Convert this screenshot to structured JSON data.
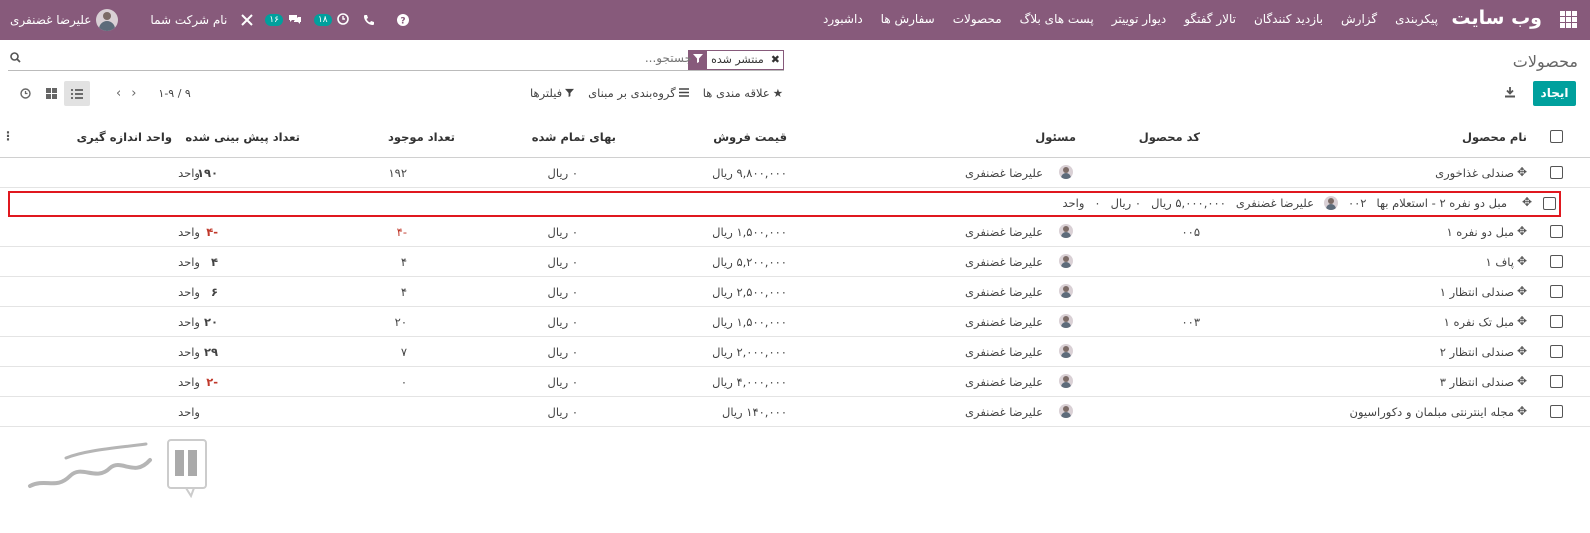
{
  "topbar": {
    "brand": "وب سایت",
    "menu": [
      "داشبورد",
      "سفارش ها",
      "محصولات",
      "پست های بلاگ",
      "دیوار توییتر",
      "تالار گفتگو",
      "بازدید کنندگان",
      "گزارش",
      "پیکربندی"
    ],
    "user_name": "علیرضا غضنفری",
    "company": "نام شرکت شما",
    "messages_badge": "۱۶",
    "activities_badge": "۱۸",
    "icons": [
      "apps-grid-icon",
      "help-icon",
      "phone-icon",
      "clock-icon",
      "chat-icon",
      "tools-icon"
    ],
    "colors": {
      "bar": "#875a7b",
      "accent": "#00a09d"
    }
  },
  "control": {
    "title": "محصولات",
    "facet_label": "منتشر شده",
    "search_placeholder": "جستجو...",
    "create_label": "ایجاد",
    "filters_label": "فیلترها",
    "groupby_label": "گروه‌بندی بر مبنای",
    "favorites_label": "علاقه مندی ها",
    "pager": "۱-۹ / ۹"
  },
  "table": {
    "headers": {
      "name": "نام محصول",
      "code": "کد محصول",
      "responsible": "مسئول",
      "price": "قیمت فروش",
      "cost": "بهای تمام شده",
      "onhand": "تعداد موجود",
      "forecast": "تعداد پیش بینی شده",
      "uom": "واحد اندازه گیری"
    },
    "rows": [
      {
        "name": "صندلی غذاخوری",
        "code": "",
        "responsible": "علیرضا غضنفری",
        "price": "۹,۸۰۰,۰۰۰ ریال",
        "cost": "۰ ریال",
        "onhand": "۱۹۲",
        "forecast": "۱۹۰",
        "uom": "واحد",
        "neg": false
      },
      {
        "name": "مبل دو نفره ۱",
        "code": "۰۰۵",
        "responsible": "علیرضا غضنفری",
        "price": "۱,۵۰۰,۰۰۰ ریال",
        "cost": "۰ ریال",
        "onhand": "-۴",
        "forecast": "-۴",
        "uom": "واحد",
        "neg": true
      },
      {
        "name": "پاف ۱",
        "code": "",
        "responsible": "علیرضا غضنفری",
        "price": "۵,۲۰۰,۰۰۰ ریال",
        "cost": "۰ ریال",
        "onhand": "۴",
        "forecast": "۴",
        "uom": "واحد",
        "neg": false
      },
      {
        "name": "صندلی انتظار ۱",
        "code": "",
        "responsible": "علیرضا غضنفری",
        "price": "۲,۵۰۰,۰۰۰ ریال",
        "cost": "۰ ریال",
        "onhand": "۴",
        "forecast": "۶",
        "uom": "واحد",
        "neg": false
      },
      {
        "name": "مبل تک نفره ۱",
        "code": "۰۰۳",
        "responsible": "علیرضا غضنفری",
        "price": "۱,۵۰۰,۰۰۰ ریال",
        "cost": "۰ ریال",
        "onhand": "۲۰",
        "forecast": "۲۰",
        "uom": "واحد",
        "neg": false
      },
      {
        "name": "صندلی انتظار ۲",
        "code": "",
        "responsible": "علیرضا غضنفری",
        "price": "۲,۰۰۰,۰۰۰ ریال",
        "cost": "۰ ریال",
        "onhand": "۷",
        "forecast": "۲۹",
        "uom": "واحد",
        "neg": false
      },
      {
        "name": "صندلی انتظار ۳",
        "code": "",
        "responsible": "علیرضا غضنفری",
        "price": "۴,۰۰۰,۰۰۰ ریال",
        "cost": "۰ ریال",
        "onhand": "۰",
        "forecast": "-۲",
        "uom": "واحد",
        "neg": true
      },
      {
        "name": "مجله اینترنتی مبلمان و دکوراسیون",
        "code": "",
        "responsible": "علیرضا غضنفری",
        "price": "۱۴۰,۰۰۰ ریال",
        "cost": "۰ ریال",
        "onhand": "",
        "forecast": "",
        "uom": "واحد",
        "neg": false
      }
    ],
    "inline_row": {
      "name": "مبل دو نفره ۲ - استعلام بها",
      "code": "۰۰۲",
      "responsible": "علیرضا غضنفری",
      "price": "۵,۰۰۰,۰۰۰ ریال",
      "cost": "۰ ریال",
      "onhand": "۰",
      "uom": "واحد"
    }
  }
}
